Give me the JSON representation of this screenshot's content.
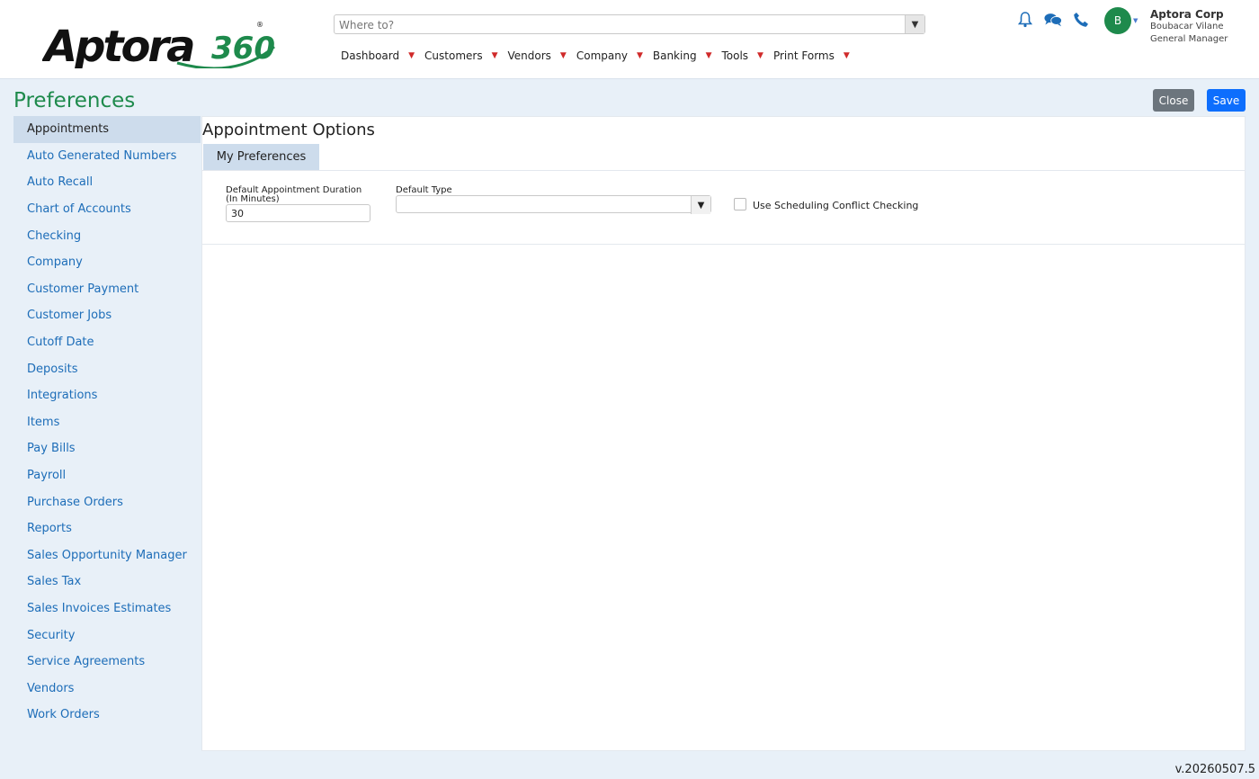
{
  "header": {
    "logo_text": "Aptora",
    "logo_suffix": "360",
    "search_placeholder": "Where to?",
    "nav": [
      "Dashboard",
      "Customers",
      "Vendors",
      "Company",
      "Banking",
      "Tools",
      "Print Forms"
    ],
    "icons": [
      "bell-icon",
      "chat-icon",
      "phone-icon"
    ],
    "avatar_letter": "B",
    "company": "Aptora Corp",
    "user_name": "Boubacar Vilane",
    "user_role": "General Manager"
  },
  "page": {
    "title": "Preferences",
    "close_label": "Close",
    "save_label": "Save"
  },
  "sidebar": {
    "items": [
      "Appointments",
      "Auto Generated Numbers",
      "Auto Recall",
      "Chart of Accounts",
      "Checking",
      "Company",
      "Customer Payment",
      "Customer Jobs",
      "Cutoff Date",
      "Deposits",
      "Integrations",
      "Items",
      "Pay Bills",
      "Payroll",
      "Purchase Orders",
      "Reports",
      "Sales Opportunity Manager",
      "Sales Tax",
      "Sales Invoices Estimates",
      "Security",
      "Service Agreements",
      "Vendors",
      "Work Orders"
    ],
    "active": "Appointments"
  },
  "panel": {
    "title": "Appointment Options",
    "tab": "My Preferences",
    "duration_label_1": "Default Appointment Duration",
    "duration_label_2": "(In Minutes)",
    "duration_value": "30",
    "type_label": "Default Type",
    "type_value": "",
    "checkbox_label": "Use Scheduling Conflict Checking",
    "checkbox_checked": false
  },
  "version": "v.20260507.5",
  "colors": {
    "brand_green": "#1e8a4c",
    "link_blue": "#1d6db8",
    "save_blue": "#0d6efd",
    "close_gray": "#6c757d",
    "nav_caret_red": "#d02a2a"
  }
}
